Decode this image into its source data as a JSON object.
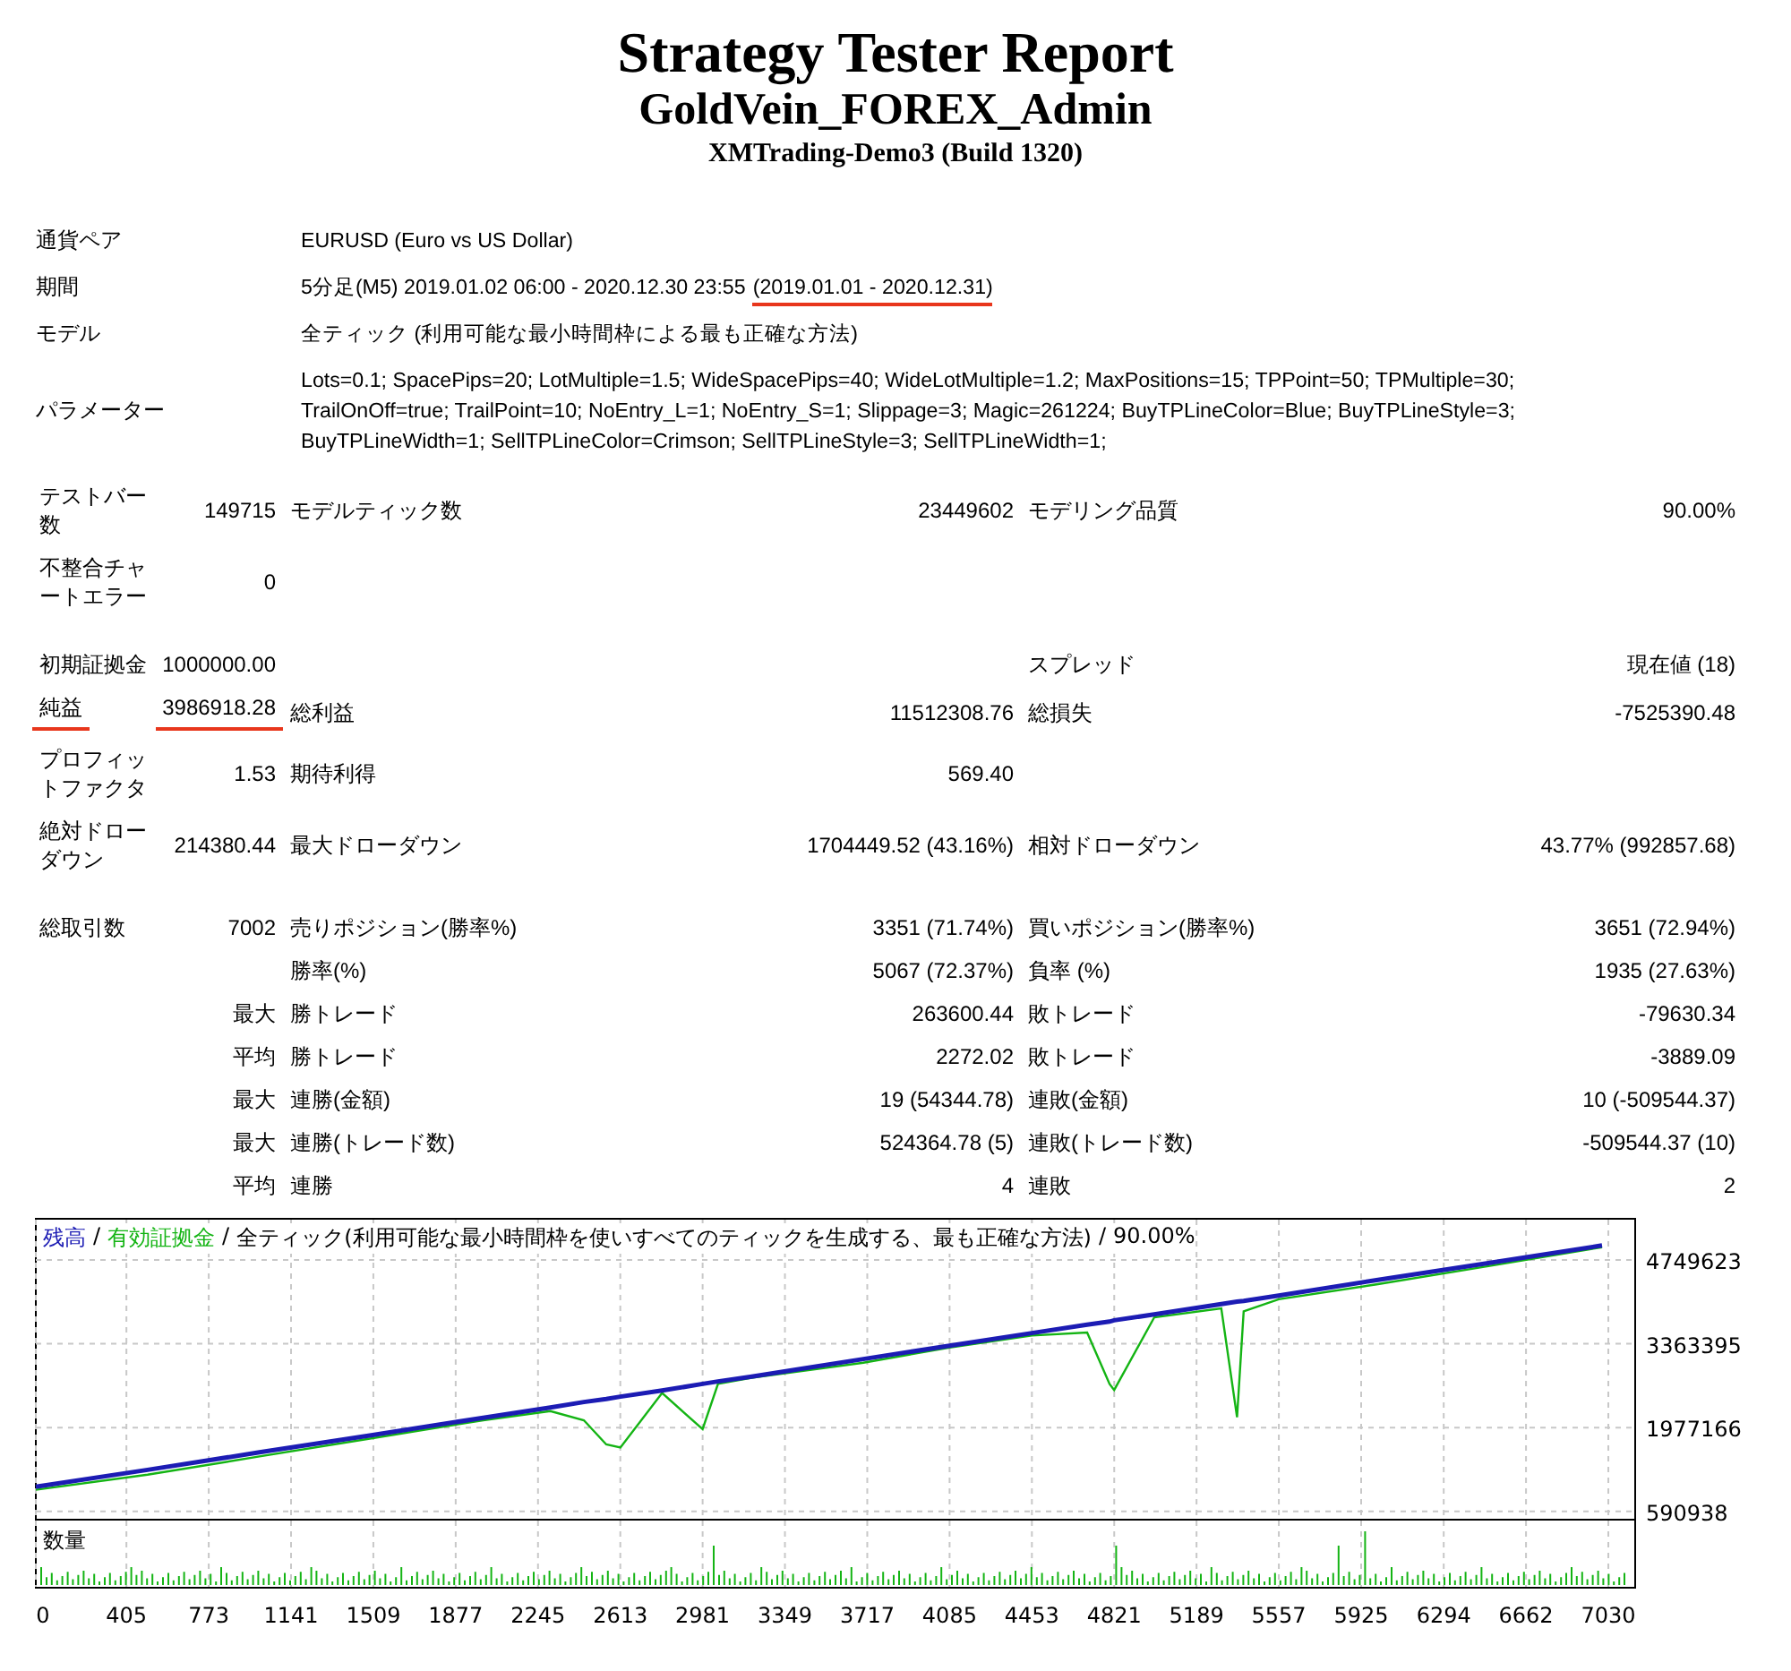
{
  "header": {
    "title": "Strategy Tester Report",
    "subtitle": "GoldVein_FOREX_Admin",
    "server": "XMTrading-Demo3 (Build 1320)"
  },
  "info": [
    {
      "label": "通貨ペア",
      "value": [
        {
          "text": "EURUSD (Euro vs US Dollar)",
          "underlined": false
        }
      ]
    },
    {
      "label": "期間",
      "value": [
        {
          "text": "5分足(M5) 2019.01.02 06:00 - 2020.12.30 23:55",
          "underlined": false
        },
        {
          "text": "(2019.01.01 - 2020.12.31)",
          "underlined": true
        }
      ]
    },
    {
      "label": "モデル",
      "value": [
        {
          "text": "全ティック (利用可能な最小時間枠による最も正確な方法)",
          "underlined": false
        }
      ]
    },
    {
      "label": "パラメーター",
      "value": [
        {
          "text": "Lots=0.1; SpacePips=20; LotMultiple=1.5; WideSpacePips=40; WideLotMultiple=1.2; MaxPositions=15; TPPoint=50; TPMultiple=30; TrailOnOff=true; TrailPoint=10; NoEntry_L=1; NoEntry_S=1; Slippage=3; Magic=261224; BuyTPLineColor=Blue; BuyTPLineStyle=3; BuyTPLineWidth=1; SellTPLineColor=Crimson; SellTPLineStyle=3; SellTPLineWidth=1;",
          "underlined": false
        }
      ]
    }
  ],
  "stats": [
    [
      {
        "label": {
          "text": "テストバー数"
        },
        "value": {
          "text": "149715"
        },
        "label2": {
          "text": "モデルティック数"
        },
        "value2": {
          "text": "23449602"
        },
        "label3": {
          "text": "モデリング品質"
        },
        "value3": {
          "text": "90.00%"
        }
      },
      {
        "label": {
          "text": "不整合チャートエラー"
        },
        "value": {
          "text": "0"
        }
      }
    ],
    [
      {
        "label": {
          "text": "初期証拠金"
        },
        "value": {
          "text": "1000000.00"
        },
        "label3": {
          "text": "スプレッド"
        },
        "value3": {
          "text": "現在値 (18)"
        }
      },
      {
        "label": {
          "text": "純益",
          "underlined": true
        },
        "value": {
          "text": "3986918.28",
          "underlined": true
        },
        "label2": {
          "text": "総利益"
        },
        "value2": {
          "text": "11512308.76"
        },
        "label3": {
          "text": "総損失"
        },
        "value3": {
          "text": "-7525390.48"
        }
      },
      {
        "label": {
          "text": "プロフィットファクタ"
        },
        "value": {
          "text": "1.53"
        },
        "label2": {
          "text": "期待利得"
        },
        "value2": {
          "text": "569.40"
        }
      },
      {
        "label": {
          "text": "絶対ドローダウン"
        },
        "value": {
          "text": "214380.44"
        },
        "label2": {
          "text": "最大ドローダウン"
        },
        "value2": {
          "text": "1704449.52 (43.16%)"
        },
        "label3": {
          "text": "相対ドローダウン"
        },
        "value3": {
          "text": "43.77% (992857.68)"
        }
      }
    ],
    [
      {
        "label": {
          "text": "総取引数"
        },
        "value": {
          "text": "7002"
        },
        "label2": {
          "text": "売りポジション(勝率%)"
        },
        "value2": {
          "text": "3351 (71.74%)"
        },
        "label3": {
          "text": "買いポジション(勝率%)"
        },
        "value3": {
          "text": "3651 (72.94%)"
        }
      },
      {
        "label2": {
          "text": "勝率(%)"
        },
        "value2": {
          "text": "5067 (72.37%)"
        },
        "label3": {
          "text": "負率 (%)"
        },
        "value3": {
          "text": "1935 (27.63%)"
        }
      },
      {
        "value": {
          "text": "最大"
        },
        "label2": {
          "text": "勝トレード"
        },
        "value2": {
          "text": "263600.44"
        },
        "label3": {
          "text": "敗トレード"
        },
        "value3": {
          "text": "-79630.34"
        }
      },
      {
        "value": {
          "text": "平均"
        },
        "label2": {
          "text": "勝トレード"
        },
        "value2": {
          "text": "2272.02"
        },
        "label3": {
          "text": "敗トレード"
        },
        "value3": {
          "text": "-3889.09"
        }
      },
      {
        "value": {
          "text": "最大"
        },
        "label2": {
          "text": "連勝(金額)"
        },
        "value2": {
          "text": "19 (54344.78)"
        },
        "label3": {
          "text": "連敗(金額)"
        },
        "value3": {
          "text": "10 (-509544.37)"
        }
      },
      {
        "value": {
          "text": "最大"
        },
        "label2": {
          "text": "連勝(トレード数)"
        },
        "value2": {
          "text": "524364.78 (5)"
        },
        "label3": {
          "text": "連敗(トレード数)"
        },
        "value3": {
          "text": "-509544.37 (10)"
        }
      },
      {
        "value": {
          "text": "平均"
        },
        "label2": {
          "text": "連勝"
        },
        "value2": {
          "text": "4"
        },
        "label3": {
          "text": "連敗"
        },
        "value3": {
          "text": "2"
        }
      }
    ]
  ],
  "chart": {
    "separator": "/",
    "caption": [
      "全ティック(利用可能な最小時間枠を使いすべてのティックを生成する、最も正確な方法)",
      "90.00%"
    ],
    "volume_label": "数量",
    "chart_data": {
      "type": "line",
      "grid": true,
      "x": [
        0,
        500,
        1000,
        1500,
        2000,
        2300,
        2450,
        2550,
        2613,
        2800,
        2981,
        3050,
        3200,
        3700,
        4085,
        4453,
        4700,
        4800,
        4821,
        5000,
        5300,
        5370,
        5400,
        5557,
        6000,
        6500,
        7002
      ],
      "series": [
        {
          "name": "残高",
          "color": "#1c1cb4",
          "values": [
            1000000,
            1280000,
            1570000,
            1850000,
            2140000,
            2310000,
            2400000,
            2450000,
            2490000,
            2590000,
            2700000,
            2740000,
            2820000,
            3110000,
            3330000,
            3540000,
            3680000,
            3730000,
            3750000,
            3850000,
            4020000,
            4060000,
            4070000,
            4160000,
            4420000,
            4700000,
            4990000
          ]
        },
        {
          "name": "有効証拠金",
          "color": "#14b414",
          "values": [
            950000,
            1200000,
            1500000,
            1800000,
            2100000,
            2250000,
            2100000,
            1700000,
            1650000,
            2550000,
            1950000,
            2700000,
            2800000,
            3050000,
            3300000,
            3500000,
            3550000,
            2700000,
            2600000,
            3800000,
            3950000,
            2150000,
            3900000,
            4100000,
            4350000,
            4650000,
            4960000
          ]
        }
      ],
      "xlim": [
        0,
        7150
      ],
      "ylim": [
        500000,
        5415000
      ],
      "xticks": [
        0,
        405,
        773,
        1141,
        1509,
        1877,
        2245,
        2613,
        2981,
        3349,
        3717,
        4085,
        4453,
        4821,
        5189,
        5557,
        5925,
        6294,
        6662,
        7030
      ],
      "yticks": [
        590938,
        1977166,
        3363395,
        4749623
      ]
    }
  }
}
